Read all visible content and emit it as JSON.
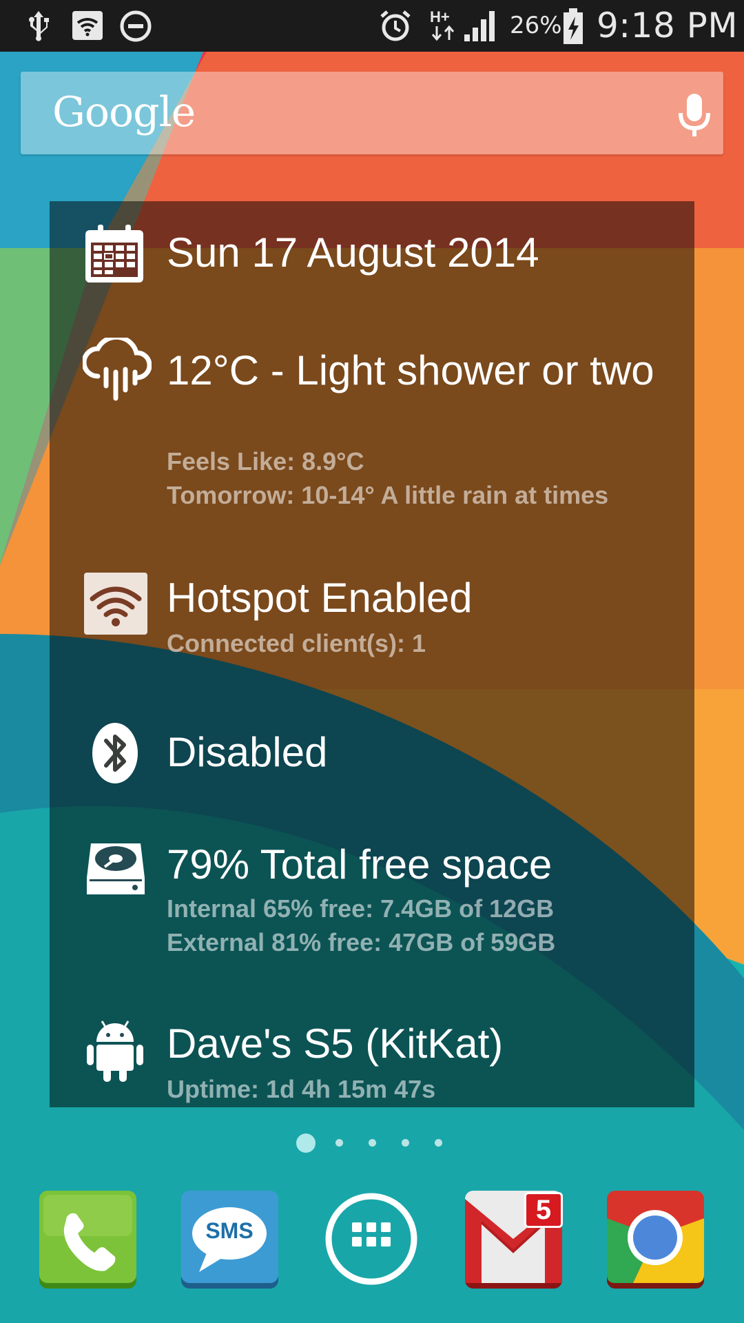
{
  "status_bar": {
    "battery_percent": "26%",
    "time": "9:18 PM",
    "left_icons": [
      "usb-icon",
      "wifi-hotspot-icon",
      "do-not-disturb-icon"
    ],
    "right_icons": [
      "alarm-icon",
      "hplus-data-icon",
      "signal-icon",
      "battery-charging-icon"
    ]
  },
  "search": {
    "logo_text": "Google",
    "mic_icon": "mic-icon"
  },
  "widget": {
    "date": {
      "icon": "calendar-icon",
      "title": "Sun 17 August 2014"
    },
    "weather": {
      "icon": "rain-cloud-icon",
      "title": "12°C - Light shower or two",
      "feels_like": "Feels Like: 8.9°C",
      "tomorrow": "Tomorrow: 10-14° A little rain at times"
    },
    "hotspot": {
      "icon": "wifi-icon",
      "title": "Hotspot Enabled",
      "clients": "Connected client(s): 1"
    },
    "bluetooth": {
      "icon": "bluetooth-icon",
      "title": "Disabled"
    },
    "storage": {
      "icon": "hard-drive-icon",
      "title": "79% Total free space",
      "internal": "Internal 65% free: 7.4GB of 12GB",
      "external": "External 81% free: 47GB of 59GB"
    },
    "device": {
      "icon": "android-icon",
      "title": "Dave's S5 (KitKat)",
      "uptime": "Uptime: 1d 4h 15m 47s"
    }
  },
  "page_indicator": {
    "count": 5,
    "active": 1
  },
  "dock": {
    "apps": [
      {
        "name": "Phone",
        "icon": "phone-icon"
      },
      {
        "name": "Messaging",
        "icon": "sms-icon",
        "label": "SMS"
      },
      {
        "name": "Apps",
        "icon": "app-drawer-icon"
      },
      {
        "name": "Gmail",
        "icon": "gmail-icon",
        "badge": "5"
      },
      {
        "name": "Chrome",
        "icon": "chrome-icon"
      }
    ]
  }
}
